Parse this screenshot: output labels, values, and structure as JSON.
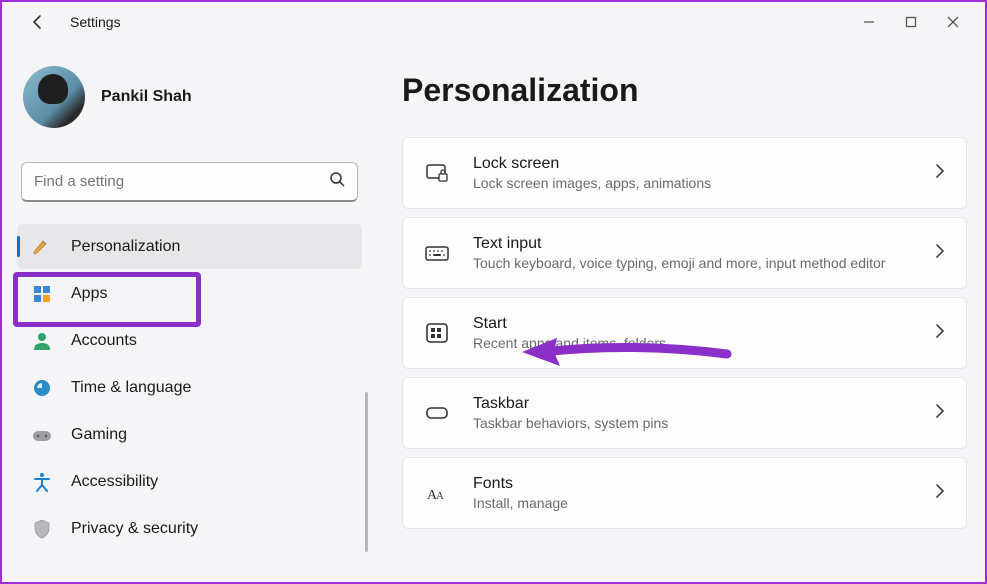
{
  "window": {
    "title": "Settings"
  },
  "user": {
    "name": "Pankil Shah"
  },
  "search": {
    "placeholder": "Find a setting"
  },
  "sidebar": {
    "items": [
      {
        "label": "Personalization",
        "icon": "personalization"
      },
      {
        "label": "Apps",
        "icon": "apps"
      },
      {
        "label": "Accounts",
        "icon": "accounts"
      },
      {
        "label": "Time & language",
        "icon": "time"
      },
      {
        "label": "Gaming",
        "icon": "gaming"
      },
      {
        "label": "Accessibility",
        "icon": "accessibility"
      },
      {
        "label": "Privacy & security",
        "icon": "privacy"
      }
    ],
    "selected_index": 0
  },
  "page": {
    "title": "Personalization"
  },
  "items": [
    {
      "title": "Lock screen",
      "sub": "Lock screen images, apps, animations",
      "icon": "lock"
    },
    {
      "title": "Text input",
      "sub": "Touch keyboard, voice typing, emoji and more, input method editor",
      "icon": "keyboard"
    },
    {
      "title": "Start",
      "sub": "Recent apps and items, folders",
      "icon": "start"
    },
    {
      "title": "Taskbar",
      "sub": "Taskbar behaviors, system pins",
      "icon": "taskbar"
    },
    {
      "title": "Fonts",
      "sub": "Install, manage",
      "icon": "fonts"
    }
  ],
  "annotations": {
    "highlight_sidebar_index": 0,
    "arrow_target_item_index": 2
  }
}
